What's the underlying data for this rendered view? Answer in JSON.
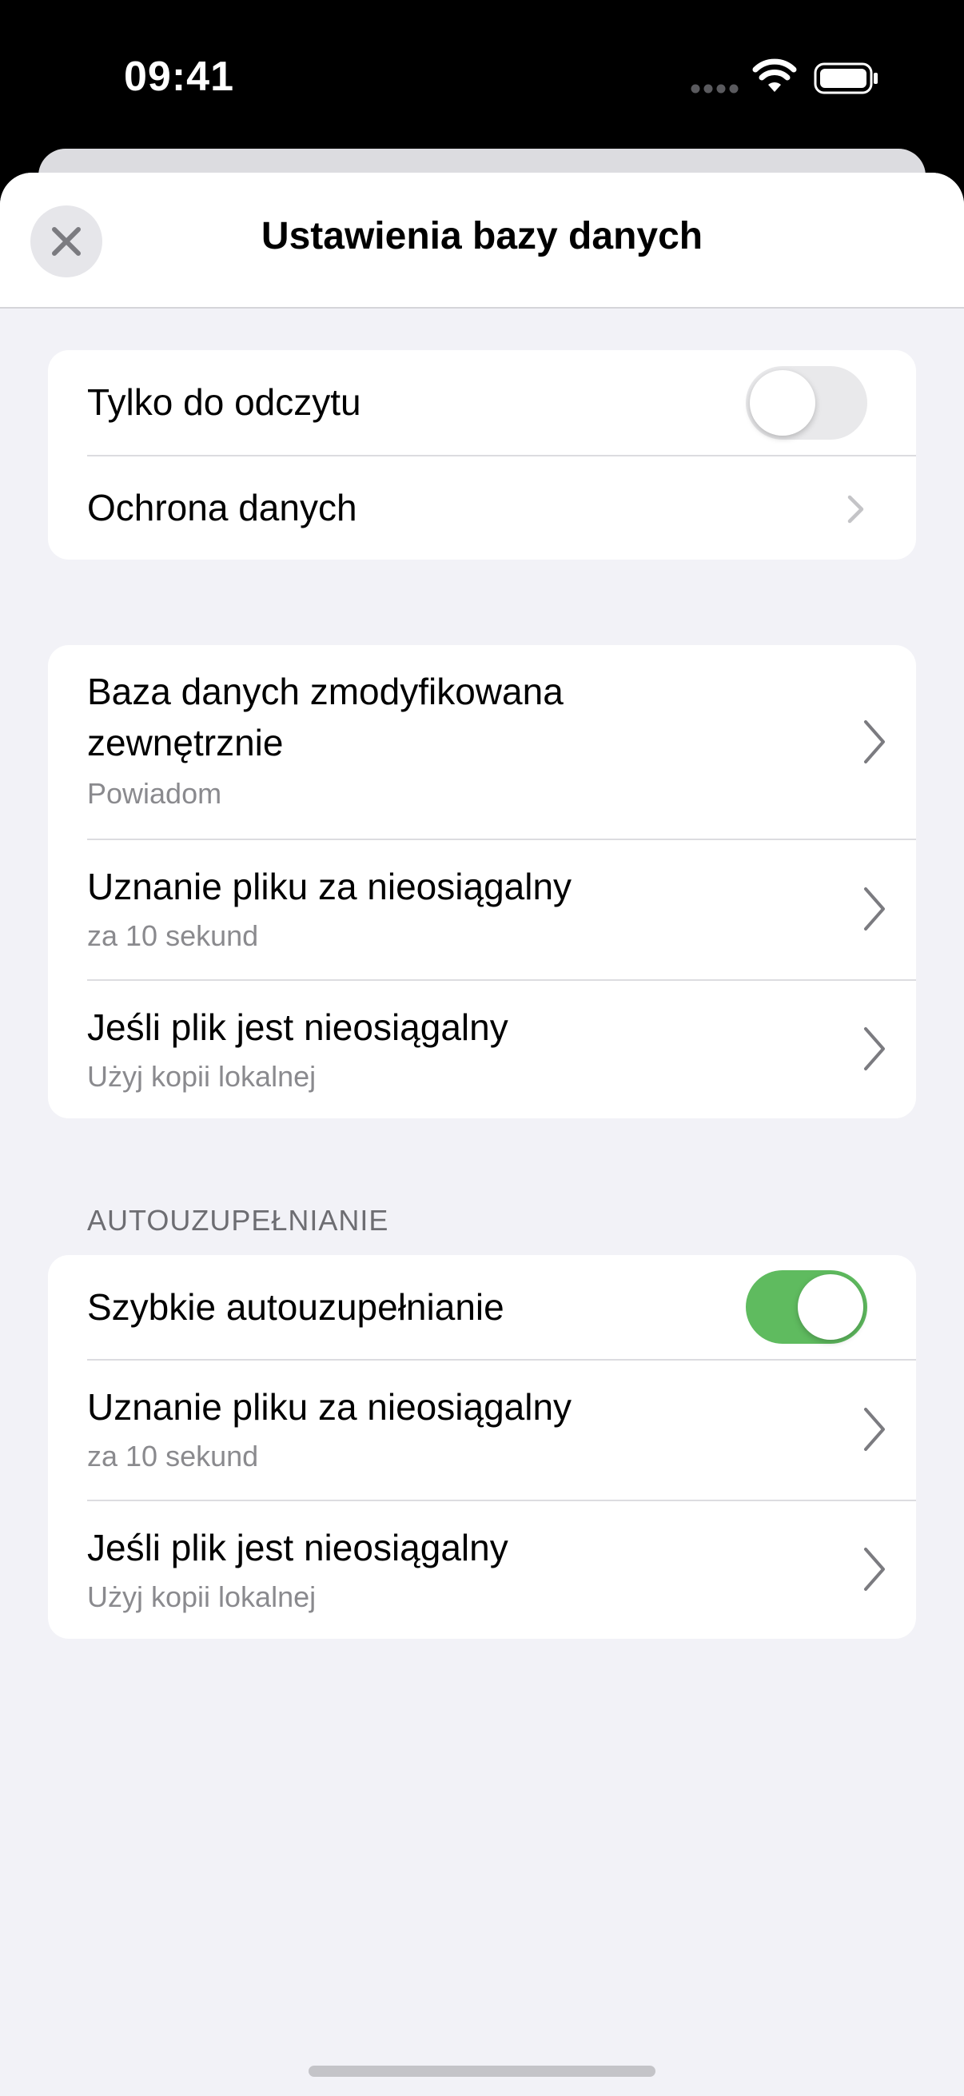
{
  "status_bar": {
    "time": "09:41"
  },
  "nav": {
    "title": "Ustawienia bazy danych",
    "close_icon": "close-icon"
  },
  "group1": {
    "read_only": {
      "label": "Tylko do odczytu",
      "enabled": false
    },
    "data_protection": {
      "label": "Ochrona danych"
    }
  },
  "group2": {
    "modified_externally": {
      "label_line1": "Baza danych zmodyfikowana",
      "label_line2": "zewnętrznie",
      "value": "Powiadom"
    },
    "unreachable_timeout": {
      "label": "Uznanie pliku za nieosiągalny",
      "value": "za 10 sekund"
    },
    "if_unreachable": {
      "label": "Jeśli plik jest nieosiągalny",
      "value": "Użyj kopii lokalnej"
    }
  },
  "autofill": {
    "header": "AUTOUZUPEŁNIANIE",
    "quick_autofill": {
      "label": "Szybkie autouzupełnianie",
      "enabled": true
    },
    "unreachable_timeout": {
      "label": "Uznanie pliku za nieosiągalny",
      "value": "za 10 sekund"
    },
    "if_unreachable": {
      "label": "Jeśli plik jest nieosiągalny",
      "value": "Użyj kopii lokalnej"
    }
  },
  "colors": {
    "toggle_on": "#5fbb5f",
    "toggle_off": "#e9e9eb",
    "background": "#f2f2f7",
    "secondary_text": "#8a8a8e"
  }
}
